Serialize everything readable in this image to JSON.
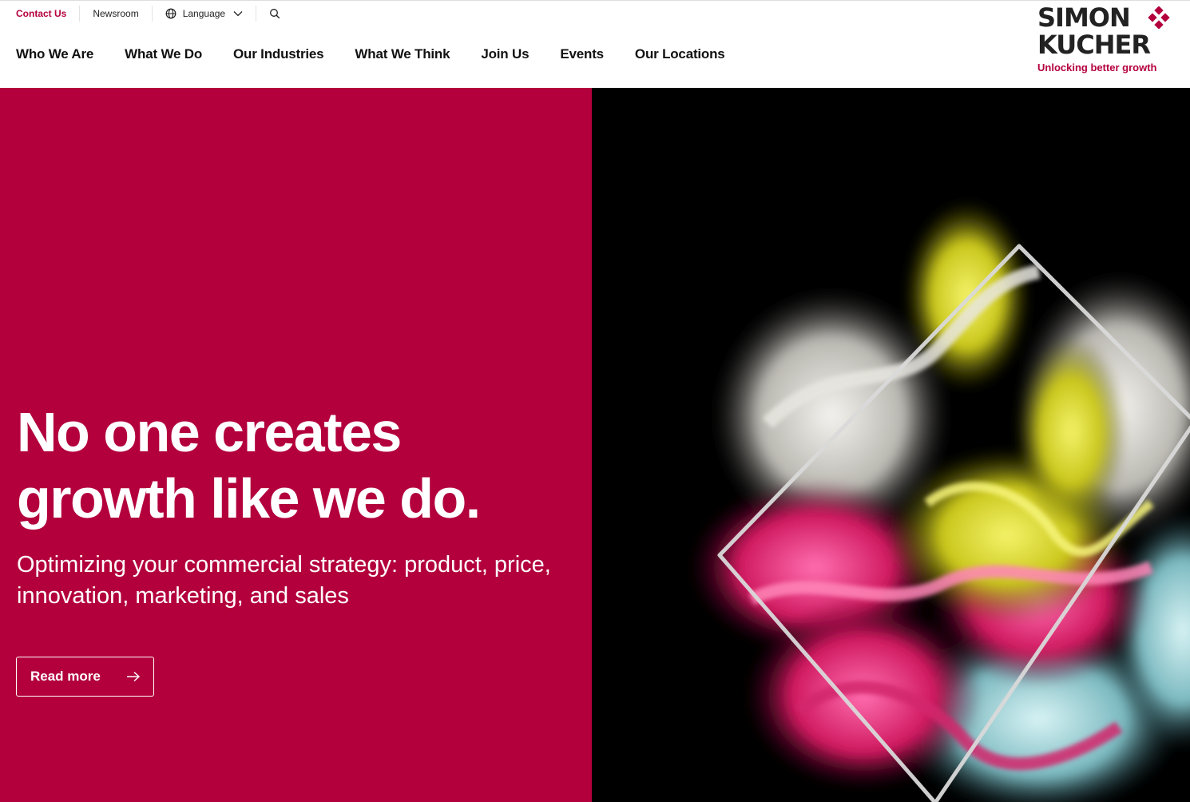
{
  "utility_nav": {
    "contact_us": "Contact Us",
    "newsroom": "Newsroom",
    "language": "Language"
  },
  "main_nav": {
    "items": [
      {
        "label": "Who We Are"
      },
      {
        "label": "What We Do"
      },
      {
        "label": "Our Industries"
      },
      {
        "label": "What We Think"
      },
      {
        "label": "Join Us"
      },
      {
        "label": "Events"
      },
      {
        "label": "Our Locations"
      }
    ]
  },
  "logo": {
    "line1": "SIMON",
    "line2": "KUCHER",
    "tagline": "Unlocking better growth"
  },
  "hero": {
    "headline_line1": "No one creates",
    "headline_line2": "growth like we do.",
    "subheadline": "Optimizing your commercial strategy: product, price, innovation, marketing, and sales",
    "cta_label": "Read more"
  },
  "colors": {
    "brand": "#b3003d",
    "hero_image_bg": "#000000",
    "text_dark": "#111111"
  },
  "icons": {
    "globe": "globe-icon",
    "chevron": "chevron-down-icon",
    "search": "search-icon",
    "arrow": "arrow-right-icon",
    "logo_mark": "diamond-dots-icon"
  }
}
